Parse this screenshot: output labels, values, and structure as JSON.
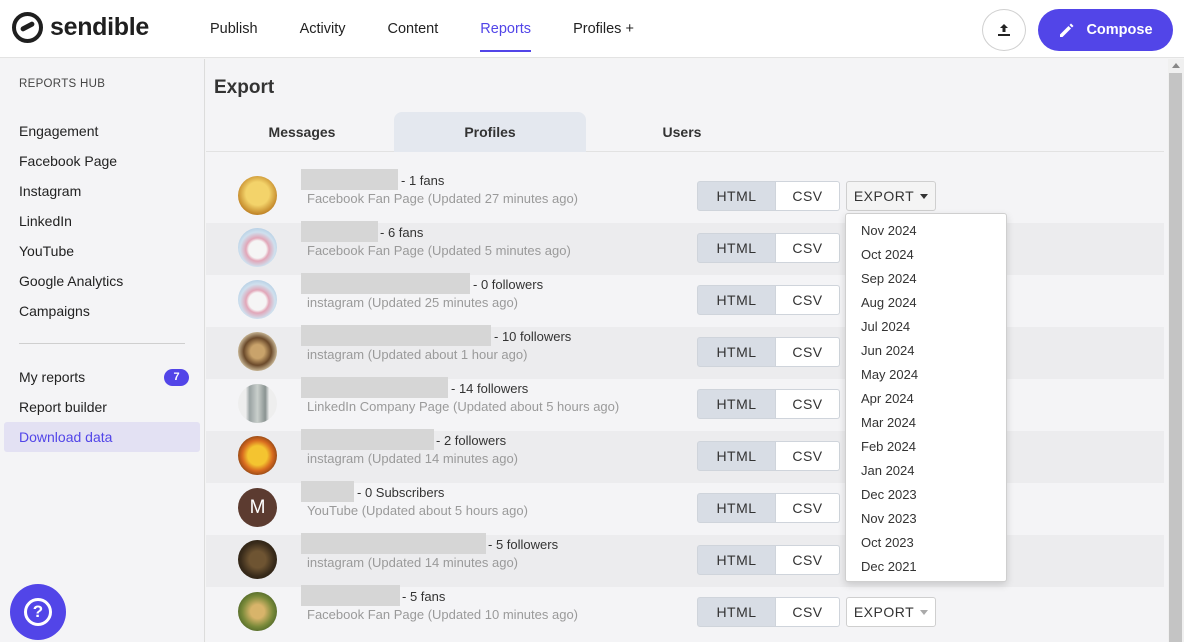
{
  "brand": {
    "name": "sendible",
    "accent": "#5245e8"
  },
  "nav": {
    "items": [
      {
        "label": "Publish"
      },
      {
        "label": "Activity"
      },
      {
        "label": "Content"
      },
      {
        "label": "Reports",
        "active": true
      },
      {
        "label": "Profiles +"
      }
    ]
  },
  "header": {
    "upload_icon": "upload-icon",
    "compose_label": "Compose"
  },
  "sidebar": {
    "title": "REPORTS HUB",
    "items": [
      {
        "label": "Engagement"
      },
      {
        "label": "Facebook Page"
      },
      {
        "label": "Instagram"
      },
      {
        "label": "LinkedIn"
      },
      {
        "label": "YouTube"
      },
      {
        "label": "Google Analytics"
      },
      {
        "label": "Campaigns"
      }
    ],
    "secondary": [
      {
        "label": "My reports",
        "badge": "7"
      },
      {
        "label": "Report builder"
      },
      {
        "label": "Download data",
        "active": true
      }
    ]
  },
  "main": {
    "title": "Export",
    "tabs": [
      {
        "label": "Messages"
      },
      {
        "label": "Profiles",
        "active": true
      },
      {
        "label": "Users"
      }
    ],
    "buttons": {
      "html": "HTML",
      "csv": "CSV",
      "export": "EXPORT"
    },
    "profiles": [
      {
        "stat": "- 1 fans",
        "subtitle": "Facebook Fan Page (Updated 27 minutes ago)"
      },
      {
        "stat": "- 6 fans",
        "subtitle": "Facebook Fan Page (Updated 5 minutes ago)"
      },
      {
        "stat": "- 0 followers",
        "subtitle": "instagram (Updated 25 minutes ago)"
      },
      {
        "stat": "- 10 followers",
        "subtitle": "instagram (Updated about 1 hour ago)"
      },
      {
        "stat": "- 14 followers",
        "subtitle": "LinkedIn Company Page (Updated about 5 hours ago)"
      },
      {
        "stat": "- 2 followers",
        "subtitle": "instagram (Updated 14 minutes ago)"
      },
      {
        "stat": "- 0 Subscribers",
        "subtitle": "YouTube (Updated about 5 hours ago)",
        "avatar_letter": "M"
      },
      {
        "stat": "- 5 followers",
        "subtitle": "instagram (Updated 14 minutes ago)"
      },
      {
        "stat": "- 5 fans",
        "subtitle": "Facebook Fan Page (Updated 10 minutes ago)"
      }
    ]
  },
  "export_dropdown": {
    "options": [
      "Nov 2024",
      "Oct 2024",
      "Sep 2024",
      "Aug 2024",
      "Jul 2024",
      "Jun 2024",
      "May 2024",
      "Apr 2024",
      "Mar 2024",
      "Feb 2024",
      "Jan 2024",
      "Dec 2023",
      "Nov 2023",
      "Oct 2023",
      "Dec 2021"
    ]
  }
}
